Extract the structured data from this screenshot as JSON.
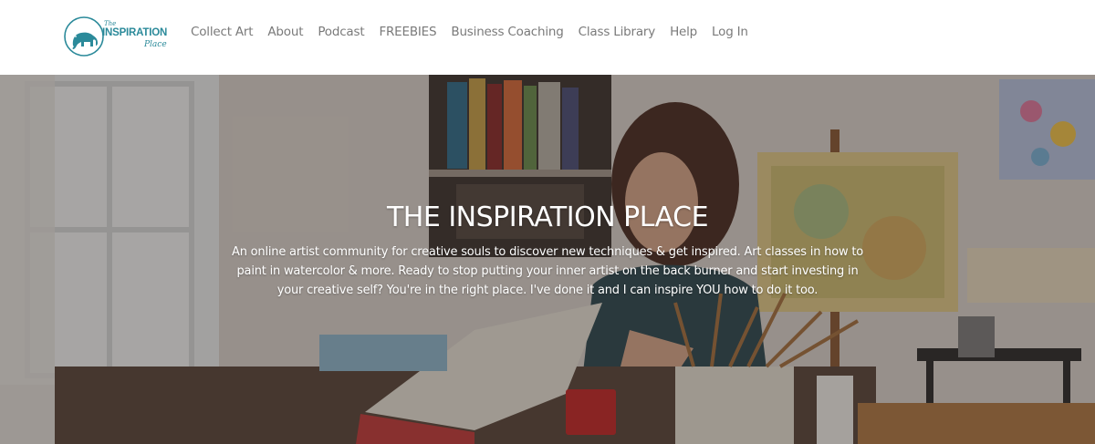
{
  "brand": {
    "the": "The",
    "name": "INSPIRATION",
    "place": "Place",
    "color": "#2b8a9a"
  },
  "nav": {
    "items": [
      {
        "label": "Collect Art"
      },
      {
        "label": "About"
      },
      {
        "label": "Podcast"
      },
      {
        "label": "FREEBIES"
      },
      {
        "label": "Business Coaching"
      },
      {
        "label": "Class Library"
      },
      {
        "label": "Help"
      },
      {
        "label": "Log In"
      }
    ]
  },
  "hero": {
    "title": "THE INSPIRATION PLACE",
    "description": "An online artist community for creative souls to discover new techniques & get inspired. Art classes in how to paint in watercolor & more. Ready to stop putting your inner artist on the back burner and start investing in your creative self? You're in the right place. I've done it and I can inspire YOU how to do it too."
  },
  "icons": {
    "logo": "elephant-logo-icon"
  }
}
